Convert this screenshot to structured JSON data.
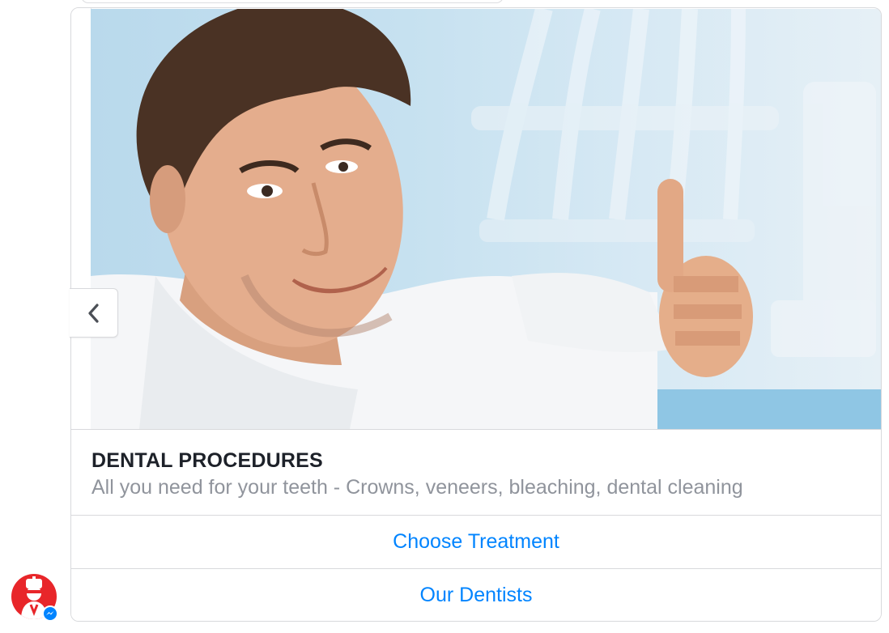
{
  "card": {
    "title": "DENTAL PROCEDURES",
    "subtitle": "All you need for your teeth - Crowns, veneers, bleaching, dental cleaning",
    "image_alt": "smiling-man-thumbs-up-dental-office"
  },
  "buttons": [
    {
      "label": "Choose Treatment"
    },
    {
      "label": "Our Dentists"
    }
  ],
  "navigation": {
    "prev_icon": "chevron-left-icon"
  },
  "bot": {
    "avatar_icon": "dentist-avatar-icon",
    "badge_icon": "messenger-badge-icon"
  },
  "colors": {
    "accent": "#0084ff",
    "title": "#1d2129",
    "subtitle": "#90949c",
    "border": "#d8d9dc",
    "avatar_bg": "#e8262a"
  }
}
